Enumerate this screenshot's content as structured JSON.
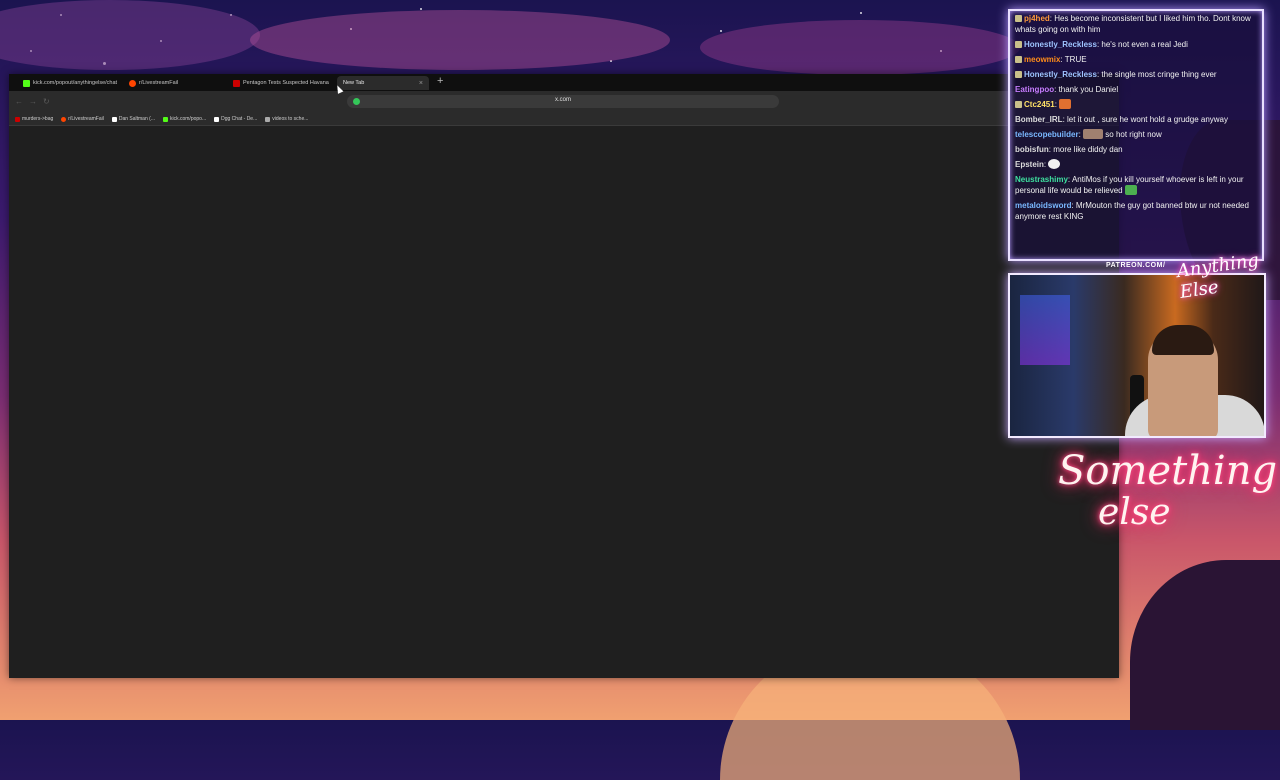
{
  "browser": {
    "tabs": [
      {
        "label": "kick.com/popout/anythingelse/chat",
        "active": false,
        "favicon_color": "#53fc18"
      },
      {
        "label": "r/LivestreamFail",
        "active": false,
        "favicon_color": "#ff4500"
      },
      {
        "label": "Pentagon Tests Suspected Havana",
        "active": false,
        "favicon_color": "#cc0000"
      },
      {
        "label": "New Tab",
        "active": true,
        "favicon_color": ""
      }
    ],
    "new_tab_symbol": "+",
    "tab_close_symbol": "×",
    "address": "x.com",
    "bookmarks": [
      {
        "label": "murders->bag",
        "favicon_color": "#cc0000"
      },
      {
        "label": "r/LivestreamFail",
        "favicon_color": "#ff4500"
      },
      {
        "label": "Dan Saltman (...",
        "favicon_color": "#ffffff"
      },
      {
        "label": "kick.com/popo...",
        "favicon_color": "#53fc18"
      },
      {
        "label": "Dgg Chat - De...",
        "favicon_color": "#ffffff"
      },
      {
        "label": "videos to sche...",
        "favicon_color": "#aaaaaa"
      }
    ]
  },
  "chat": {
    "messages": [
      {
        "user": "pj4hed",
        "color": "#ff9a3c",
        "badge": true,
        "text": "Hes become inconsistent but I liked him tho. Dont know whats going on with him"
      },
      {
        "user": "Honestly_Reckless",
        "color": "#9ec4ff",
        "badge": true,
        "text": "he's not even a real Jedi"
      },
      {
        "user": "meowmix",
        "color": "#ff8c1a",
        "badge": true,
        "text": "TRUE"
      },
      {
        "user": "Honestly_Reckless",
        "color": "#9ec4ff",
        "badge": true,
        "text": "the single most cringe thing ever"
      },
      {
        "user": "Eatingpoo",
        "color": "#c77dff",
        "badge": false,
        "text": "thank you Daniel"
      },
      {
        "user": "Ctc2451",
        "color": "#ffe066",
        "badge": true,
        "text": "",
        "emote_color": "#e07030"
      },
      {
        "user": "Bomber_IRL",
        "color": "#dddddd",
        "badge": false,
        "text": "let it out , sure he wont hold a grudge anyway"
      },
      {
        "user": "telescopebuilder",
        "color": "#7ab8ff",
        "badge": false,
        "text": "so hot right now",
        "emote_color": "#a08070"
      },
      {
        "user": "bobisfun",
        "color": "#dddddd",
        "badge": false,
        "text": "more like diddy dan"
      },
      {
        "user": "Epstein",
        "color": "#dddddd",
        "badge": false,
        "text": "",
        "emote_color": "#f0f0f0"
      },
      {
        "user": "Neustrashimy",
        "color": "#3ee0a0",
        "badge": false,
        "text": "AntiMos if you kill yourself whoever is left in your personal life would be relieved",
        "emote_color": "#4caf50"
      },
      {
        "user": "metaloidsword",
        "color": "#7ab8ff",
        "badge": false,
        "text": "MrMouton the guy got banned btw ur not needed anymore rest KING"
      }
    ]
  },
  "overlay": {
    "patreon": "PATREON.COM/",
    "brand_logo": "Anything Else",
    "neon_line1": "Something",
    "neon_line2": "else"
  },
  "colors": {
    "browser_bg": "#1f1f1f",
    "chat_border": "#e9e0ff",
    "neon_glow": "#ff2f6a"
  }
}
